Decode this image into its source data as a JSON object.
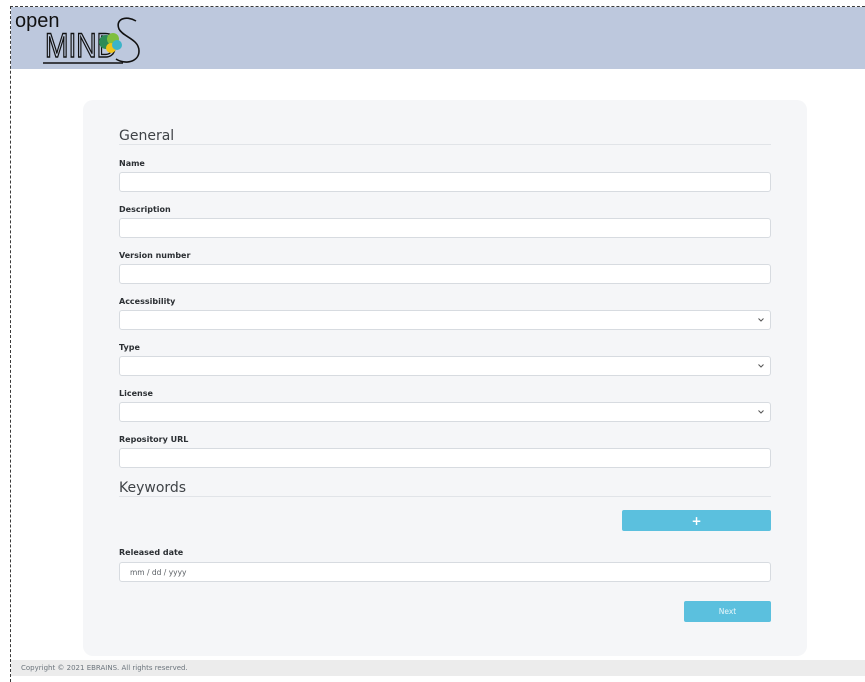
{
  "header": {
    "logo": {
      "word_top": "open",
      "word_main": "MIND",
      "brain_colors": [
        "#2e8b57",
        "#7fbf3f",
        "#f0c419",
        "#3cb4c8"
      ]
    }
  },
  "form": {
    "general_title": "General",
    "fields": {
      "name": {
        "label": "Name",
        "value": ""
      },
      "description": {
        "label": "Description",
        "value": ""
      },
      "version_number": {
        "label": "Version number",
        "value": ""
      },
      "accessibility": {
        "label": "Accessibility",
        "value": ""
      },
      "type": {
        "label": "Type",
        "value": ""
      },
      "license": {
        "label": "License",
        "value": ""
      },
      "repository_url": {
        "label": "Repository URL",
        "value": ""
      }
    },
    "keywords_title": "Keywords",
    "add_keyword_label": "+",
    "released_date": {
      "label": "Released date",
      "placeholder": "mm / dd / yyyy"
    },
    "next_label": "Next"
  },
  "footer": {
    "copyright": "Copyright © 2021 EBRAINS. All rights reserved."
  },
  "colors": {
    "header_bg": "#bdc8dd",
    "button_accent": "#5bc0de",
    "card_bg": "#f5f6f8"
  }
}
